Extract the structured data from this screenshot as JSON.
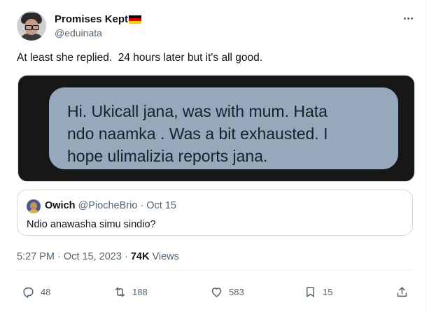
{
  "author": {
    "display_name": "Promises Kept",
    "flag_icon": "germany-flag-icon",
    "flag_colors": [
      "#000000",
      "#dd0000",
      "#ffce00"
    ],
    "handle": "@eduinata"
  },
  "tweet": {
    "text": "At least she replied.  24 hours later but it's all good."
  },
  "media": {
    "lines": [
      "Hi. Ukicall jana, was with mum. Hata",
      "ndo naamka . Was a bit exhausted. I",
      "hope ulimalizia reports jana."
    ],
    "bubble_color": "#96a9ba",
    "background_color": "#171717"
  },
  "quote": {
    "name": "Owich",
    "meta": "@PiocheBrio · Oct 15",
    "text": "Ndio anawasha simu sindio?"
  },
  "timestamp": {
    "time_date": "5:27 PM · Oct 15, 2023 · ",
    "views_count": "74K",
    "views_label": " Views"
  },
  "actions": {
    "replies": "48",
    "reposts": "188",
    "likes": "583",
    "bookmarks": "15"
  },
  "colors": {
    "text_primary": "#0f1419",
    "text_secondary": "#536471",
    "border": "#cfd9de"
  }
}
